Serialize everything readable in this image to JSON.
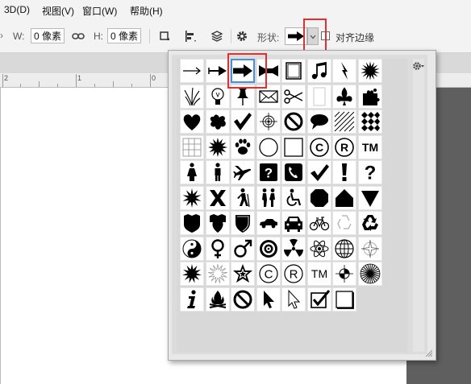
{
  "menu": {
    "items": [
      {
        "id": "3d",
        "label": "3D(D)"
      },
      {
        "id": "view",
        "label": "视图(V)"
      },
      {
        "id": "window",
        "label": "窗口(W)"
      },
      {
        "id": "help",
        "label": "帮助(H)"
      }
    ]
  },
  "options": {
    "w_label": "W:",
    "w_value": "0 像素",
    "h_label": "H:",
    "h_value": "0 像素",
    "shape_label": "形状:",
    "align_edges_label": "对齐边缘"
  },
  "ruler": {
    "labels": [
      "2",
      "1",
      "0"
    ]
  },
  "shape_picker": {
    "selected_shape": "arrow-9",
    "shapes": [
      [
        "arrow-thin",
        "arrow-5",
        "arrow-9",
        "banner",
        "frame-border-2",
        "eighth-notes",
        "lightning",
        "boom-1"
      ],
      [
        "grass",
        "light-bulb",
        "thumbtack",
        "envelope",
        "scissors",
        "blank-frame",
        "fleur-de-lis",
        "puzzle"
      ],
      [
        "heart",
        "ink-blot",
        "checkmark",
        "target",
        "no-symbol",
        "talk-bubble",
        "diagonal-lines",
        "diamond-grid"
      ],
      [
        "grid",
        "boom-2",
        "paw-print",
        "circle-frame",
        "square-frame",
        "copyright",
        "registered",
        "trademark"
      ],
      [
        "female",
        "male",
        "airplane",
        "help",
        "telephone",
        "checkmark-2",
        "exclamation",
        "question"
      ],
      [
        "boom-3",
        "x-mark",
        "hiker",
        "pedestrian",
        "handicapped",
        "stop-sign",
        "school-zone",
        "yield"
      ],
      [
        "shield-1",
        "shield-2",
        "shield-3",
        "car-side",
        "car-front",
        "bicycle",
        "recycle-light",
        "recycle"
      ],
      [
        "yin-yang",
        "female-symbol",
        "male-symbol",
        "bullseye",
        "radioactive",
        "atom",
        "globe",
        "compass"
      ],
      [
        "boom-4",
        "boom-light",
        "star-badge",
        "copyright-2",
        "registered-2",
        "trademark-2",
        "registration-target",
        "sunburst"
      ],
      [
        "information",
        "campfire",
        "no-symbol-2",
        "pointer",
        "pointer-outline",
        "checkbox-checked",
        "checkbox-empty"
      ]
    ]
  },
  "colors": {
    "highlight": "#e03131",
    "selection": "#4a90d9"
  }
}
